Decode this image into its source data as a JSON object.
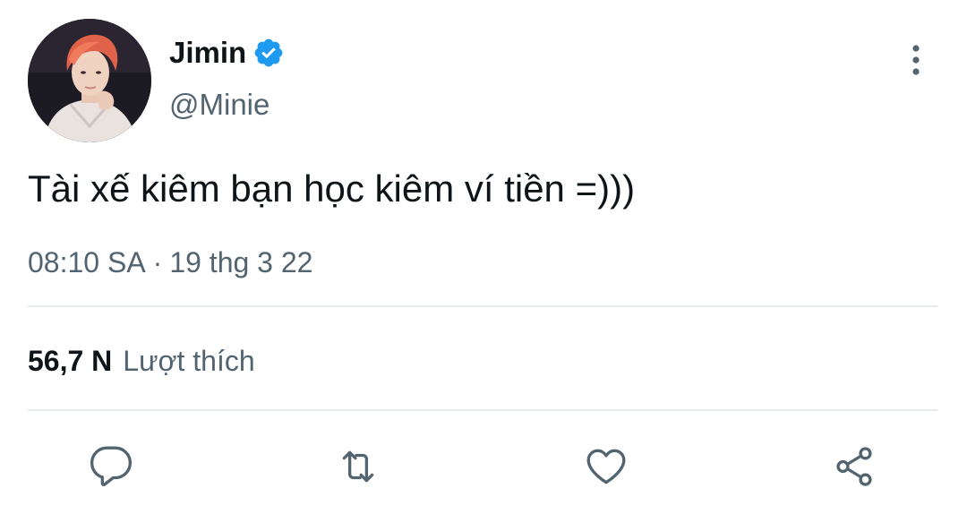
{
  "author": {
    "display_name": "Jimin",
    "handle": "@Minie",
    "verified": true,
    "verified_color": "#1d9bf0"
  },
  "tweet": {
    "text": "Tài xế kiêm bạn học kiêm ví tiền =)))"
  },
  "meta": {
    "time": "08:10 SA",
    "separator": "·",
    "date": "19 thg 3 22"
  },
  "stats": {
    "likes_count": "56,7 N",
    "likes_label": "Lượt thích"
  },
  "icons": {
    "more": "more-vertical-icon",
    "reply": "reply-icon",
    "retweet": "retweet-icon",
    "like": "heart-icon",
    "share": "share-icon"
  },
  "colors": {
    "text_primary": "#0f1419",
    "text_secondary": "#536471",
    "divider": "#e7ebee",
    "icon": "#536471"
  }
}
